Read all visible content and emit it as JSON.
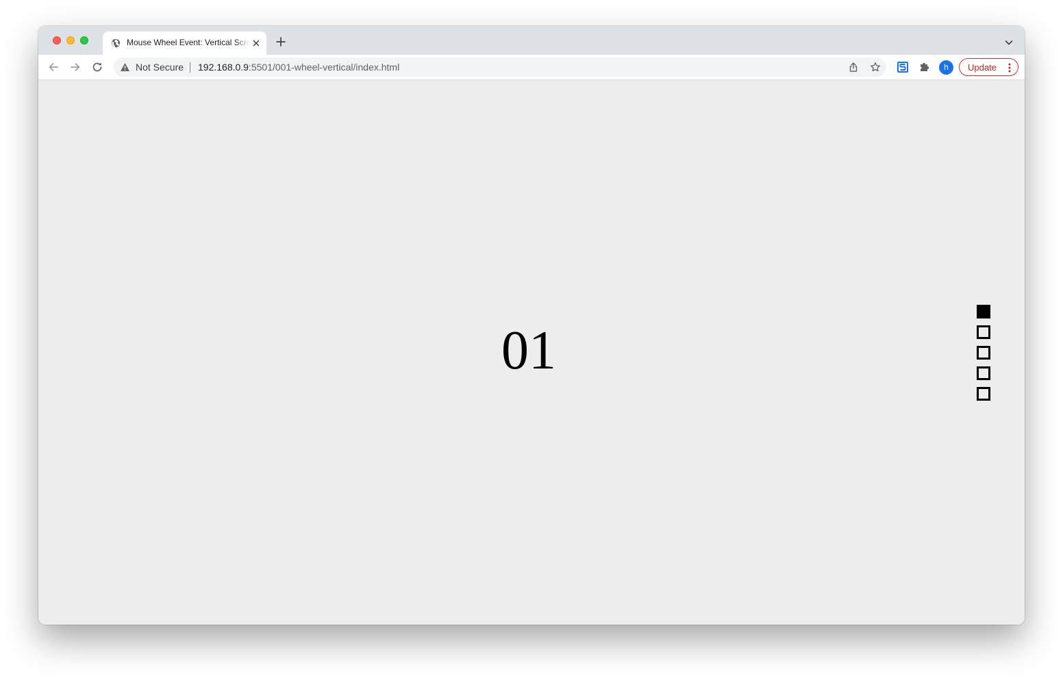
{
  "browser": {
    "tab": {
      "title": "Mouse Wheel Event: Vertical Scroll",
      "favicon": "globe-icon",
      "close_icon": "close-icon"
    },
    "new_tab_icon": "plus-icon",
    "tab_search_icon": "chevron-down-icon",
    "toolbar": {
      "back_icon": "arrow-left-icon",
      "forward_icon": "arrow-right-icon",
      "reload_icon": "reload-icon",
      "security_icon": "warning-icon",
      "security_label": "Not Secure",
      "url_host": "192.168.0.9",
      "url_rest": ":5501/001-wheel-vertical/index.html",
      "share_icon": "share-icon",
      "bookmark_icon": "star-icon",
      "extension_icons": [
        "extension-s-icon",
        "puzzle-icon"
      ],
      "profile_initial": "h",
      "update_label": "Update",
      "menu_icon": "kebab-menu-icon"
    }
  },
  "page": {
    "section_number": "01",
    "pagination": {
      "total": 5,
      "active_index": 0
    }
  },
  "colors": {
    "page_background": "#ededed",
    "dot_color": "#000000",
    "update_accent": "#d93025",
    "avatar": "#1a73e8"
  }
}
